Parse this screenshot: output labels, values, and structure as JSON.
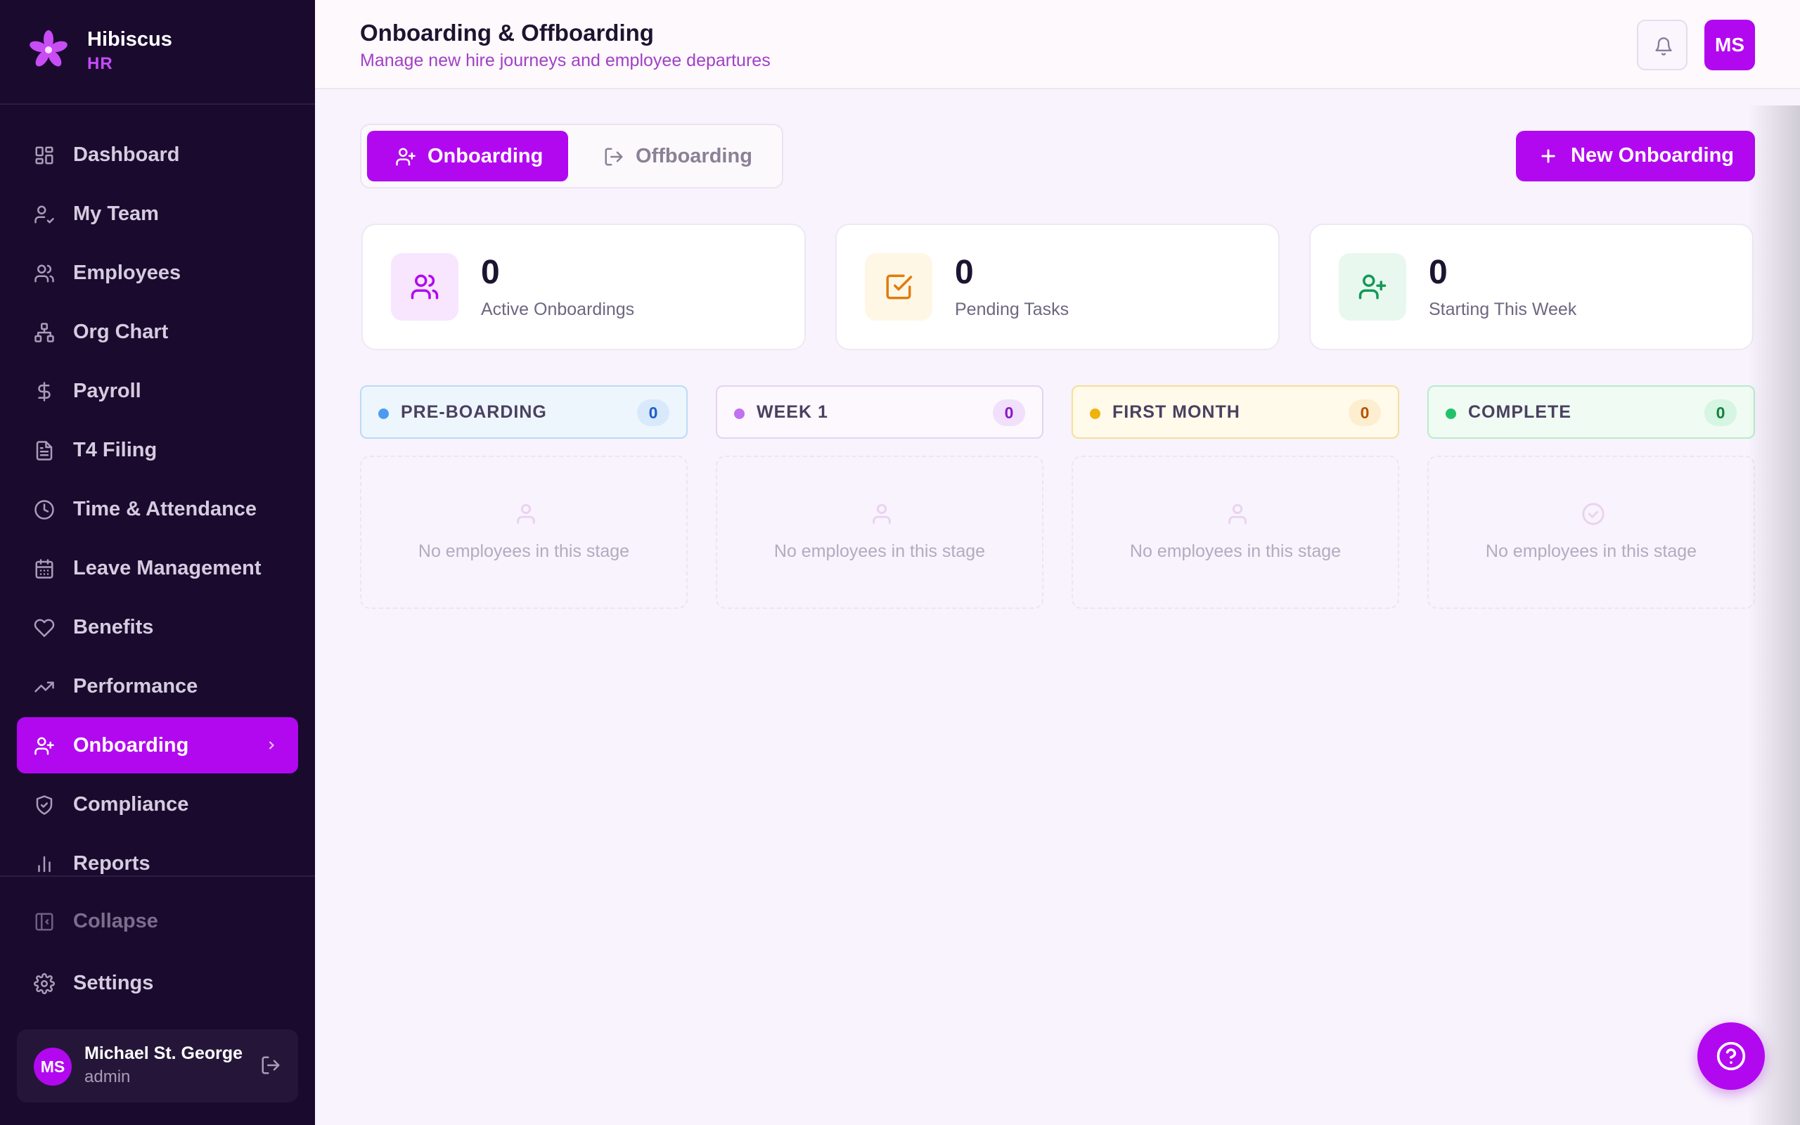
{
  "brand": {
    "name": "Hibiscus",
    "sub": "HR",
    "logo_icon": "flower-icon"
  },
  "sidebar": {
    "items": [
      {
        "label": "Dashboard",
        "icon": "dashboard-icon"
      },
      {
        "label": "My Team",
        "icon": "user-check-icon"
      },
      {
        "label": "Employees",
        "icon": "users-icon"
      },
      {
        "label": "Org Chart",
        "icon": "org-chart-icon"
      },
      {
        "label": "Payroll",
        "icon": "dollar-icon"
      },
      {
        "label": "T4 Filing",
        "icon": "document-icon"
      },
      {
        "label": "Time & Attendance",
        "icon": "clock-icon"
      },
      {
        "label": "Leave Management",
        "icon": "calendar-icon"
      },
      {
        "label": "Benefits",
        "icon": "heart-icon"
      },
      {
        "label": "Performance",
        "icon": "trending-up-icon"
      },
      {
        "label": "Onboarding",
        "icon": "user-plus-icon",
        "active": true
      },
      {
        "label": "Compliance",
        "icon": "shield-check-icon"
      },
      {
        "label": "Reports",
        "icon": "bar-chart-icon"
      }
    ],
    "collapse_label": "Collapse",
    "settings_label": "Settings",
    "user": {
      "initials": "MS",
      "name": "Michael St. George",
      "role": "admin"
    }
  },
  "header": {
    "title": "Onboarding & Offboarding",
    "subtitle": "Manage new hire journeys and employee departures",
    "avatar_initials": "MS"
  },
  "tabs": [
    {
      "label": "Onboarding",
      "active": true,
      "icon": "user-plus-icon"
    },
    {
      "label": "Offboarding",
      "active": false,
      "icon": "log-out-icon"
    }
  ],
  "new_button_label": "New Onboarding",
  "stats": [
    {
      "value": "0",
      "label": "Active Onboardings",
      "icon": "users-icon",
      "color": "#b208f0",
      "bg": "#f7e6fd"
    },
    {
      "value": "0",
      "label": "Pending Tasks",
      "icon": "check-square-icon",
      "color": "#e07c0c",
      "bg": "#fff7e6"
    },
    {
      "value": "0",
      "label": "Starting This Week",
      "icon": "user-plus-icon",
      "color": "#129a55",
      "bg": "#e8f8ef"
    }
  ],
  "stages": [
    {
      "label": "PRE-BOARDING",
      "count": "0",
      "dot": "#4d9bf0",
      "border": "#bcdaf6",
      "bg": "#eef6fd",
      "badge_bg": "#d8e9fb",
      "badge_fg": "#1f5fc4",
      "empty_icon": "user-icon"
    },
    {
      "label": "WEEK 1",
      "count": "0",
      "dot": "#c070f0",
      "border": "#e6d3f4",
      "bg": "#fcf8fe",
      "badge_bg": "#f1e0fb",
      "badge_fg": "#8a19c4",
      "empty_icon": "user-icon"
    },
    {
      "label": "FIRST MONTH",
      "count": "0",
      "dot": "#f0b30b",
      "border": "#f6df9a",
      "bg": "#fffaea",
      "badge_bg": "#fdeed0",
      "badge_fg": "#b4530a",
      "empty_icon": "user-icon"
    },
    {
      "label": "COMPLETE",
      "count": "0",
      "dot": "#22c26b",
      "border": "#b9ebcc",
      "bg": "#effbf3",
      "badge_bg": "#d6f5e2",
      "badge_fg": "#16803f",
      "empty_icon": "check-circle-icon"
    }
  ],
  "empty_text": "No employees in this stage"
}
